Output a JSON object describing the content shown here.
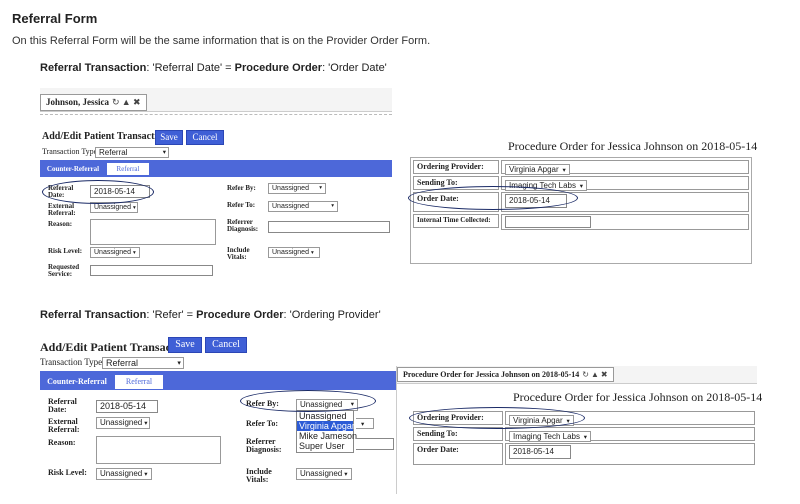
{
  "page": {
    "title": "Referral Form",
    "intro": "On this Referral Form will be the same information that is on the Provider Order Form."
  },
  "caption1": {
    "a_bold": "Referral Transaction",
    "a": ": 'Referral Date' = ",
    "b_bold": "Procedure Order",
    "b": ": 'Order Date'"
  },
  "caption2": {
    "a_bold": "Referral Transaction",
    "a": ": 'Refer' = ",
    "b_bold": "Procedure Order",
    "b": ": 'Ordering Provider'"
  },
  "shot1": {
    "tab_label": "Johnson, Jessica",
    "tab_icons": "↻ ▲ ✖",
    "heading": "Add/Edit Patient Transaction",
    "save": "Save",
    "cancel": "Cancel",
    "ttype_label": "Transaction Type:",
    "ttype_value": "Referral",
    "subtab_counter": "Counter-Referral",
    "subtab_referral": "Referral",
    "referral_date_label": "Referral Date:",
    "referral_date_value": "2018-05-14",
    "external_referral_label": "External Referral:",
    "external_referral_value": "Unassigned",
    "reason_label": "Reason:",
    "risk_label": "Risk Level:",
    "risk_value": "Unassigned",
    "requested_label": "Requested Service:",
    "refer_by_label": "Refer By:",
    "refer_by_value": "Unassigned",
    "refer_to_label": "Refer To:",
    "refer_to_value": "Unassigned",
    "referrer_dx_label": "Referrer Diagnosis:",
    "include_vitals_label": "Include Vitals:",
    "include_vitals_value": "Unassigned"
  },
  "order1": {
    "title": "Procedure Order for Jessica Johnson on 2018-05-14",
    "ordering_provider_label": "Ordering Provider:",
    "ordering_provider_value": "Virginia Apgar",
    "sending_to_label": "Sending To:",
    "sending_to_value": "Imaging Tech Labs",
    "order_date_label": "Order Date:",
    "order_date_value": "2018-05-14",
    "internal_time_label": "Internal Time Collected:"
  },
  "shot2": {
    "heading": "Add/Edit Patient Transaction",
    "save": "Save",
    "cancel": "Cancel",
    "ttype_label": "Transaction Type:",
    "ttype_value": "Referral",
    "subtab_counter": "Counter-Referral",
    "subtab_referral": "Referral",
    "referral_date_label": "Referral Date:",
    "referral_date_value": "2018-05-14",
    "external_referral_label": "External Referral:",
    "external_referral_value": "Unassigned",
    "reason_label": "Reason:",
    "risk_label": "Risk Level:",
    "risk_value": "Unassigned",
    "refer_by_label": "Refer By:",
    "refer_by_value": "Unassigned",
    "refer_by_options": [
      "Unassigned",
      "Virginia Apgar",
      "Mike Jameson",
      "Super User"
    ],
    "refer_to_label": "Refer To:",
    "referrer_dx_label": "Referrer Diagnosis:",
    "include_vitals_label": "Include Vitals:",
    "include_vitals_value": "Unassigned"
  },
  "order2": {
    "tab_label": "Procedure Order for Jessica Johnson on 2018-05-14",
    "tab_icons": "↻ ▲ ✖",
    "title": "Procedure Order for Jessica Johnson on 2018-05-14",
    "ordering_provider_label": "Ordering Provider:",
    "ordering_provider_value": "Virginia Apgar",
    "sending_to_label": "Sending To:",
    "sending_to_value": "Imaging Tech Labs",
    "order_date_label": "Order Date:",
    "order_date_value": "2018-05-14"
  },
  "colors": {
    "accent": "#4d68d9",
    "highlight_oval": "#1a2a66"
  }
}
